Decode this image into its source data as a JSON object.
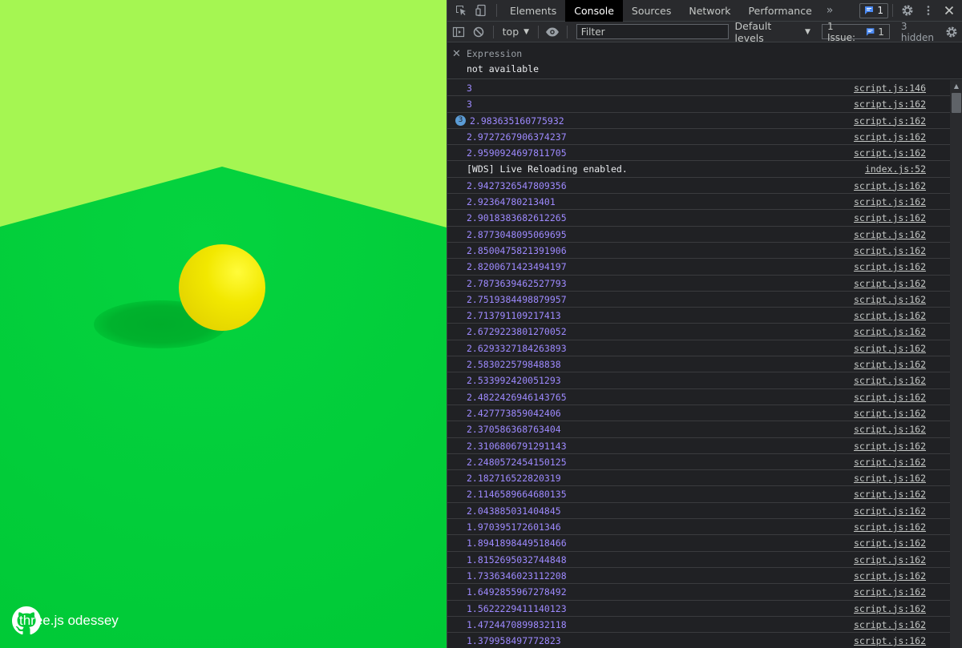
{
  "scene": {
    "brand_text": "three.js odessey",
    "sky_color": "#a5f652",
    "ground_color": "#02cc3b",
    "ball_color": "#f2e800"
  },
  "devtools": {
    "tabs": [
      "Elements",
      "Console",
      "Sources",
      "Network",
      "Performance"
    ],
    "active_tab": "Console",
    "more_tabs_icon": "double-chevron-right-icon",
    "badge_count": "1",
    "context": "top",
    "filter_placeholder": "Filter",
    "levels": "Default levels",
    "issues_label": "1 Issue:",
    "issues_count": "1",
    "hidden": "3 hidden",
    "expression_label": "Expression",
    "expression_value": "not available",
    "log": [
      {
        "msg": "3",
        "src": "script.js:146"
      },
      {
        "msg": "3",
        "src": "script.js:162"
      },
      {
        "msg": "2.983635160775932",
        "src": "script.js:162",
        "repeat": "3"
      },
      {
        "msg": "2.9727267906374237",
        "src": "script.js:162"
      },
      {
        "msg": "2.9590924697811705",
        "src": "script.js:162"
      },
      {
        "msg": "[WDS] Live Reloading enabled.",
        "src": "index.js:52",
        "kind": "text"
      },
      {
        "msg": "2.9427326547809356",
        "src": "script.js:162"
      },
      {
        "msg": "2.92364780213401",
        "src": "script.js:162"
      },
      {
        "msg": "2.9018383682612265",
        "src": "script.js:162"
      },
      {
        "msg": "2.8773048095069695",
        "src": "script.js:162"
      },
      {
        "msg": "2.8500475821391906",
        "src": "script.js:162"
      },
      {
        "msg": "2.8200671423494197",
        "src": "script.js:162"
      },
      {
        "msg": "2.7873639462527793",
        "src": "script.js:162"
      },
      {
        "msg": "2.7519384498879957",
        "src": "script.js:162"
      },
      {
        "msg": "2.713791109217413",
        "src": "script.js:162"
      },
      {
        "msg": "2.6729223801270052",
        "src": "script.js:162"
      },
      {
        "msg": "2.6293327184263893",
        "src": "script.js:162"
      },
      {
        "msg": "2.583022579848838",
        "src": "script.js:162"
      },
      {
        "msg": "2.533992420051293",
        "src": "script.js:162"
      },
      {
        "msg": "2.4822426946143765",
        "src": "script.js:162"
      },
      {
        "msg": "2.427773859042406",
        "src": "script.js:162"
      },
      {
        "msg": "2.370586368763404",
        "src": "script.js:162"
      },
      {
        "msg": "2.3106806791291143",
        "src": "script.js:162"
      },
      {
        "msg": "2.2480572454150125",
        "src": "script.js:162"
      },
      {
        "msg": "2.182716522820319",
        "src": "script.js:162"
      },
      {
        "msg": "2.1146589664680135",
        "src": "script.js:162"
      },
      {
        "msg": "2.043885031404845",
        "src": "script.js:162"
      },
      {
        "msg": "1.970395172601346",
        "src": "script.js:162"
      },
      {
        "msg": "1.8941898449518466",
        "src": "script.js:162"
      },
      {
        "msg": "1.8152695032744848",
        "src": "script.js:162"
      },
      {
        "msg": "1.7336346023112208",
        "src": "script.js:162"
      },
      {
        "msg": "1.6492855967278492",
        "src": "script.js:162"
      },
      {
        "msg": "1.5622229411140123",
        "src": "script.js:162"
      },
      {
        "msg": "1.4724470899832118",
        "src": "script.js:162"
      },
      {
        "msg": "1.379958497772823",
        "src": "script.js:162"
      }
    ]
  }
}
